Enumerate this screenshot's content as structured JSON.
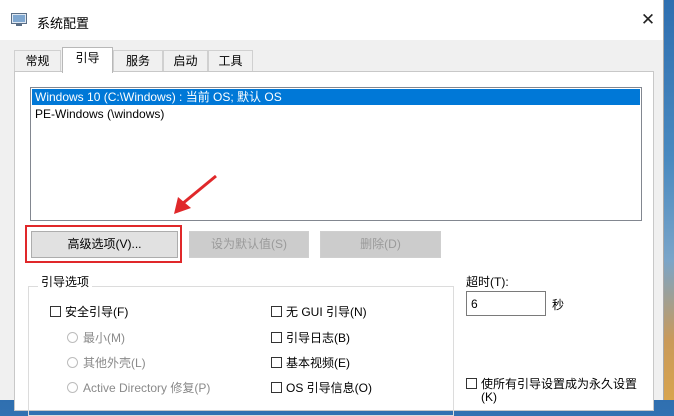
{
  "window": {
    "title": "系统配置",
    "close_glyph": "✕"
  },
  "tabs": [
    {
      "label": "常规"
    },
    {
      "label": "引导"
    },
    {
      "label": "服务"
    },
    {
      "label": "启动"
    },
    {
      "label": "工具"
    }
  ],
  "boot_entries": [
    {
      "text": "Windows 10 (C:\\Windows) : 当前 OS; 默认 OS",
      "selected": true
    },
    {
      "text": "PE-Windows (\\windows)",
      "selected": false
    }
  ],
  "buttons": {
    "advanced": "高级选项(V)...",
    "set_default": "设为默认值(S)",
    "delete": "删除(D)"
  },
  "boot_options": {
    "title": "引导选项",
    "safe_boot": "安全引导(F)",
    "minimal": "最小(M)",
    "alternate_shell": "其他外壳(L)",
    "active_directory": "Active Directory 修复(P)",
    "no_gui": "无 GUI 引导(N)",
    "boot_log": "引导日志(B)",
    "base_video": "基本视频(E)",
    "os_boot_info": "OS 引导信息(O)"
  },
  "timeout": {
    "label": "超时(T):",
    "value": "6",
    "unit": "秒"
  },
  "permanent": {
    "label": "使所有引导设置成为永久设置",
    "label_line2": "(K)"
  },
  "colors": {
    "selection": "#0078d7",
    "highlight": "#e0282a"
  }
}
